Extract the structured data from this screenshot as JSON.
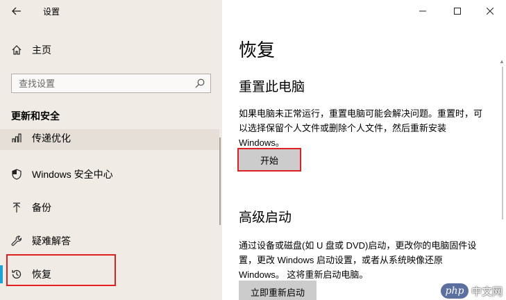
{
  "window": {
    "title": "设置"
  },
  "sidebar": {
    "home_label": "主页",
    "search_placeholder": "查找设置",
    "section_title": "更新和安全",
    "items": [
      {
        "label": "传递优化",
        "icon": "delivery-optimization-icon"
      },
      {
        "label": "Windows 安全中心",
        "icon": "shield-icon"
      },
      {
        "label": "备份",
        "icon": "backup-arrow-icon"
      },
      {
        "label": "疑难解答",
        "icon": "wrench-icon"
      },
      {
        "label": "恢复",
        "icon": "history-icon",
        "selected": true
      }
    ]
  },
  "main": {
    "title": "恢复",
    "reset": {
      "heading": "重置此电脑",
      "description": "如果电脑未正常运行，重置电脑可能会解决问题。重置时，可以选择保留个人文件或删除个人文件，然后重新安装 Windows。",
      "button": "开始"
    },
    "advanced": {
      "heading": "高级启动",
      "description": "通过设备或磁盘(如 U 盘或 DVD)启动，更改你的电脑固件设置，更改 Windows 启动设置，或者从系统映像还原 Windows。 这将重新启动电脑。",
      "button": "立即重新启动"
    }
  },
  "watermark": {
    "logo": "php",
    "text": "中文网"
  },
  "colors": {
    "sidebar_bg": "#f0ebe4",
    "accent": "#1ba3d6",
    "highlight": "#e02020",
    "button_bg": "#cccccc"
  }
}
